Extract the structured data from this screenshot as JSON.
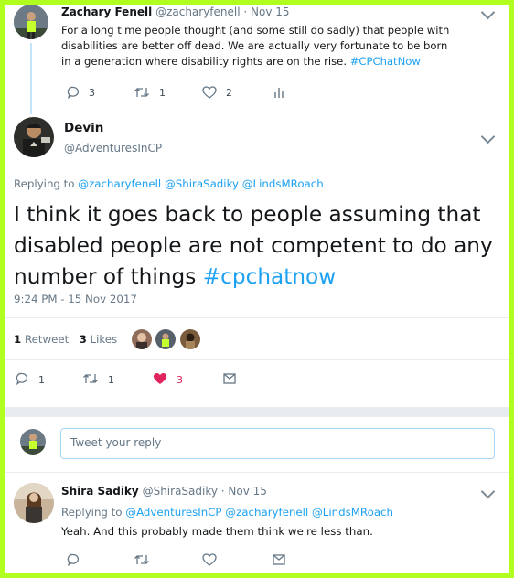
{
  "tweet1": {
    "name": "Zachary Fenell",
    "handle": "@zacharyfenell",
    "dot_date": "· Nov 15",
    "text": "For a long time people thought (and some still do sadly) that people with disabilities are better off dead. We are actually very fortunate to be born in a generation where disability rights are on the rise.",
    "hashtag": "#CPChatNow",
    "replies": "3",
    "retweets": "1",
    "likes": "2"
  },
  "tweet2": {
    "name": "Devin",
    "handle": "@AdventuresInCP",
    "replying_prefix": "Replying to",
    "replying_to": [
      "@zacharyfenell",
      "@ShiraSadiky",
      "@LindsMRoach"
    ],
    "text": "I think it goes back to people assuming that disabled people are not competent to do any number of things",
    "hashtag": "#cpchatnow",
    "timestamp": "9:24 PM - 15 Nov 2017",
    "retweet_count": "1",
    "retweet_label": "Retweet",
    "like_count": "3",
    "like_label": "Likes",
    "replies": "1",
    "retweets": "1",
    "likes": "3"
  },
  "reply_box": {
    "placeholder": "Tweet your reply"
  },
  "tweet3": {
    "name": "Shira Sadiky",
    "handle": "@ShiraSadiky",
    "dot_date": "· Nov 15",
    "replying_prefix": "Replying to",
    "replying_to": [
      "@AdventuresInCP",
      "@zacharyfenell",
      "@LindsMRoach"
    ],
    "text": "Yeah. And this probably made them think we're less than."
  },
  "colors": {
    "accent": "#1da1f2",
    "like": "#e0245e",
    "frame": "#b0ff1e"
  }
}
